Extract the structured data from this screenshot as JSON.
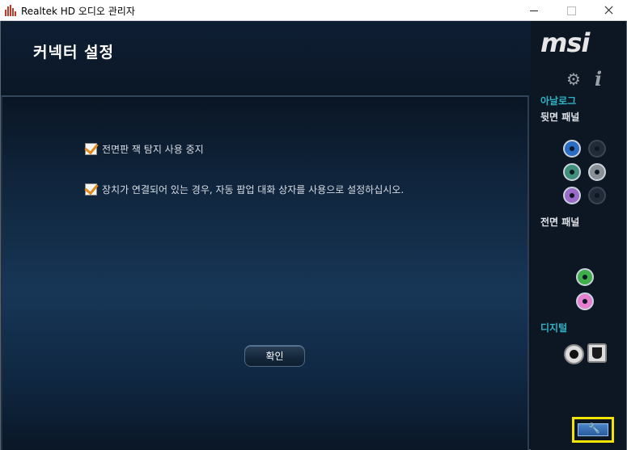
{
  "window": {
    "title": "Realtek HD 오디오 관리자"
  },
  "header": {
    "title": "커넥터 설정"
  },
  "options": [
    {
      "label": "전면판 잭 탐지 사용 중지",
      "checked": true
    },
    {
      "label": "장치가 연결되어 있는 경우, 자동 팝업 대화 상자를 사용으로 설정하십시오.",
      "checked": true
    }
  ],
  "buttons": {
    "ok_label": "확인"
  },
  "sidebar": {
    "logo": "msi",
    "analog_heading": "아날로그",
    "rear_panel_heading": "뒷면 패널",
    "front_panel_heading": "전면 패널",
    "digital_heading": "디지털",
    "icons": [
      "gear-icon",
      "info-icon",
      "wrench-icon"
    ]
  },
  "colors": {
    "accent_teal": "#2fb3c6",
    "highlight_yellow": "#f2e600",
    "checkmark_orange": "#e08a1c",
    "jack_blue": "#2b6cc4",
    "jack_green": "#3fae4a",
    "jack_pink": "#e67fd0",
    "jack_purple": "#9b6bc9",
    "jack_gray": "#8a8f96"
  },
  "jacks": {
    "rear": [
      {
        "name": "rear-line-in-jack",
        "color": "#2b6cc4",
        "active": true
      },
      {
        "name": "rear-side-jack",
        "color": "#3a6aa0",
        "active": false
      },
      {
        "name": "rear-front-out-jack",
        "color": "#3f8f7a",
        "active": true
      },
      {
        "name": "rear-mic-gray-jack",
        "color": "#8a8f96",
        "active": true
      },
      {
        "name": "rear-mic-purple-jack",
        "color": "#9b6bc9",
        "active": true
      },
      {
        "name": "rear-surround-jack",
        "color": "#5a6a80",
        "active": false
      }
    ],
    "front": [
      {
        "name": "front-headphone-jack",
        "color": "#3fae4a",
        "active": true
      },
      {
        "name": "front-mic-jack",
        "color": "#e67fd0",
        "active": true
      }
    ]
  }
}
